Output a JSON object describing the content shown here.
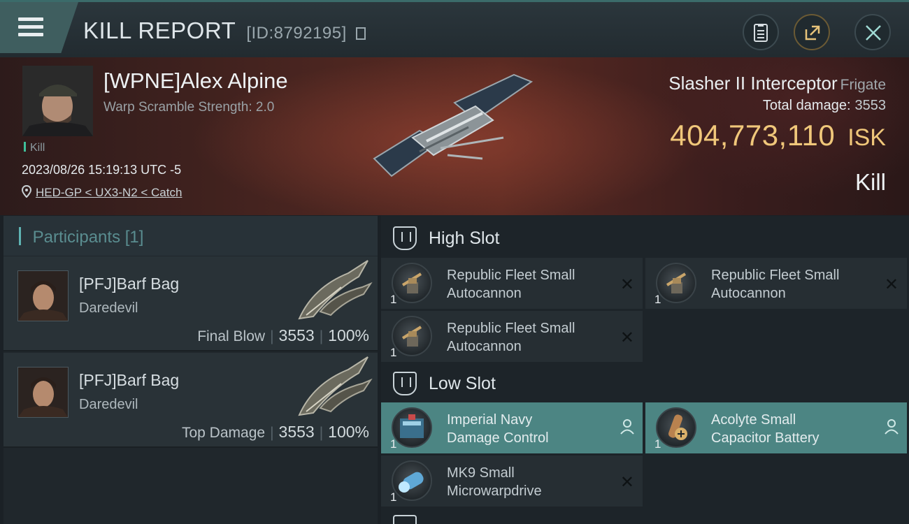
{
  "header": {
    "title": "KILL REPORT",
    "report_id": "[ID:8792195]"
  },
  "victim": {
    "name": "[WPNE]Alex Alpine",
    "scramble": "Warp Scramble Strength: 2.0",
    "kill_tag": "Kill",
    "timestamp": "2023/08/26 15:19:13 UTC -5",
    "location": "HED-GP < UX3-N2 < Catch"
  },
  "ship": {
    "name": "Slasher II Interceptor",
    "class": "Frigate",
    "total_damage_label": "Total damage:",
    "total_damage": "3553",
    "isk_value": "404,773,110",
    "isk_unit": "ISK",
    "result": "Kill"
  },
  "participants": {
    "label": "Participants",
    "count": "[1]",
    "items": [
      {
        "name": "[PFJ]Barf Bag",
        "ship": "Daredevil",
        "role": "Final Blow",
        "damage": "3553",
        "percent": "100%"
      },
      {
        "name": "[PFJ]Barf Bag",
        "ship": "Daredevil",
        "role": "Top Damage",
        "damage": "3553",
        "percent": "100%"
      }
    ]
  },
  "slots": {
    "high": {
      "title": "High Slot",
      "modules": [
        {
          "name_line1": "Republic Fleet Small",
          "name_line2": "Autocannon",
          "qty": "1",
          "state": "destroyed"
        },
        {
          "name_line1": "Republic Fleet Small",
          "name_line2": "Autocannon",
          "qty": "1",
          "state": "destroyed"
        },
        {
          "name_line1": "Republic Fleet Small",
          "name_line2": "Autocannon",
          "qty": "1",
          "state": "destroyed"
        }
      ]
    },
    "low": {
      "title": "Low Slot",
      "modules": [
        {
          "name_line1": "Imperial Navy",
          "name_line2": "Damage Control",
          "qty": "1",
          "state": "dropped"
        },
        {
          "name_line1": "Acolyte Small",
          "name_line2": "Capacitor Battery",
          "qty": "1",
          "state": "dropped"
        },
        {
          "name_line1": "MK9 Small",
          "name_line2": "Microwarpdrive",
          "qty": "1",
          "state": "destroyed"
        }
      ]
    }
  },
  "colors": {
    "isk_gold": "#f0c77a",
    "dropped_teal": "#4c8583",
    "accent_teal": "#5fb3b3"
  },
  "icons": [
    "menu-icon",
    "copy-icon",
    "document-icon",
    "share-icon",
    "close-icon",
    "location-pin-icon",
    "slot-icon",
    "x-icon",
    "user-icon"
  ]
}
